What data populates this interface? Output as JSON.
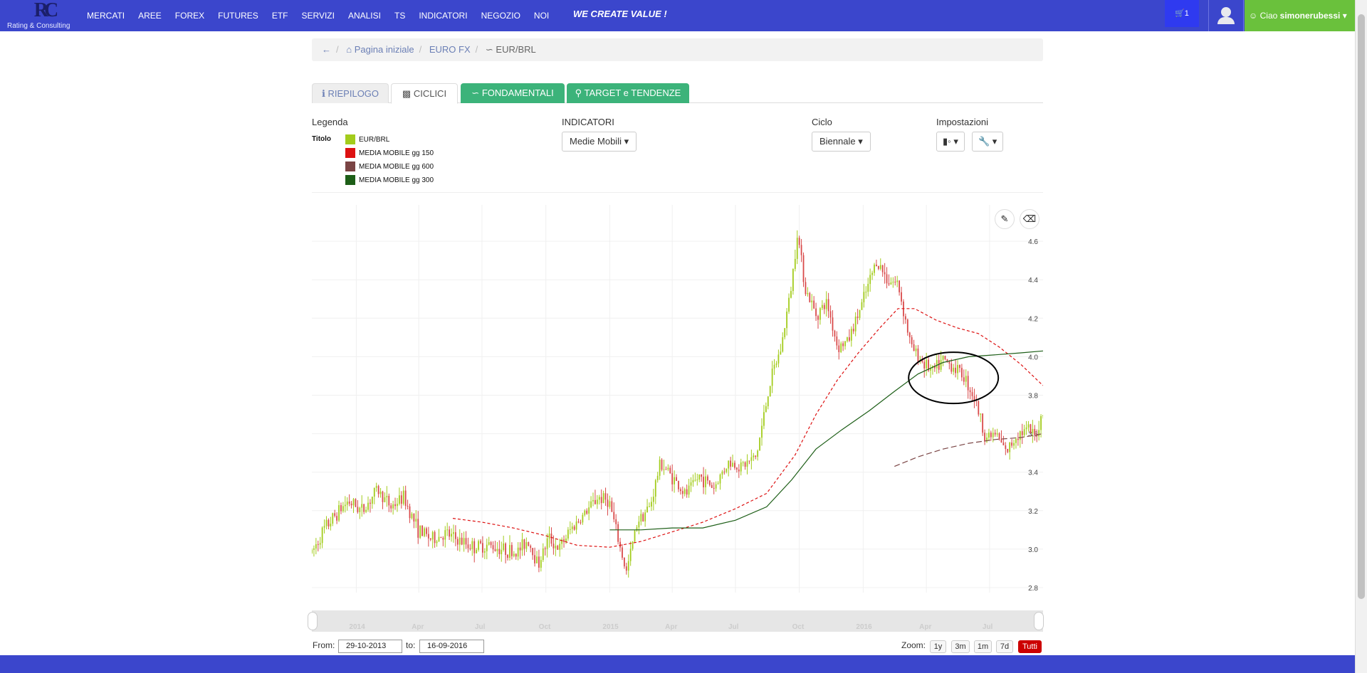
{
  "nav": {
    "logo_sub": "Rating & Consulting",
    "menu": [
      "MERCATI",
      "AREE",
      "FOREX",
      "FUTURES",
      "ETF",
      "SERVIZI",
      "ANALISI",
      "TS",
      "INDICATORI",
      "NEGOZIO",
      "NOI"
    ],
    "slogan": "WE CREATE VALUE !",
    "cart_count": "1",
    "greeting": "Ciao",
    "username": "simonerubessi"
  },
  "breadcrumb": {
    "home": "Pagina iniziale",
    "section": "EURO FX",
    "current": "EUR/BRL"
  },
  "tabs": {
    "riepilogo": "RIEPILOGO",
    "ciclici": "CICLICI",
    "fondamentali": "FONDAMENTALI",
    "target": "TARGET e TENDENZE"
  },
  "legend": {
    "title": "Legenda",
    "titolo_label": "Titolo",
    "items": [
      {
        "label": "EUR/BRL",
        "color": "#a3cc1c"
      },
      {
        "label": "MEDIA MOBILE gg 150",
        "color": "#dd1111"
      },
      {
        "label": "MEDIA MOBILE gg 600",
        "color": "#7a4444"
      },
      {
        "label": "MEDIA MOBILE gg 300",
        "color": "#1d5e17"
      }
    ]
  },
  "indicatori": {
    "title": "INDICATORI",
    "selected": "Medie Mobili"
  },
  "ciclo": {
    "title": "Ciclo",
    "selected": "Biennale"
  },
  "impostazioni": {
    "title": "Impostazioni"
  },
  "chart_data": {
    "type": "line",
    "series_name": "EUR/BRL",
    "ylim": [
      2.8,
      4.7
    ],
    "y_ticks": [
      "4.6",
      "4.4",
      "4.2",
      "4.0",
      "3.8",
      "3.6",
      "3.4",
      "3.2",
      "3.0",
      "2.8"
    ],
    "x_ticks": [
      "2014",
      "Apr",
      "Jul",
      "Oct",
      "2015",
      "Apr",
      "Jul",
      "Oct",
      "2016",
      "Apr",
      "Jul"
    ],
    "price": [
      [
        "2013-10-29",
        2.98
      ],
      [
        "2013-11-15",
        3.1
      ],
      [
        "2013-12-05",
        3.19
      ],
      [
        "2013-12-20",
        3.25
      ],
      [
        "2014-01-10",
        3.2
      ],
      [
        "2014-01-31",
        3.31
      ],
      [
        "2014-02-20",
        3.22
      ],
      [
        "2014-03-10",
        3.27
      ],
      [
        "2014-03-31",
        3.1
      ],
      [
        "2014-04-20",
        3.05
      ],
      [
        "2014-05-10",
        3.08
      ],
      [
        "2014-05-31",
        3.04
      ],
      [
        "2014-06-20",
        3.01
      ],
      [
        "2014-07-10",
        3.02
      ],
      [
        "2014-07-31",
        3.0
      ],
      [
        "2014-08-20",
        2.98
      ],
      [
        "2014-09-05",
        3.05
      ],
      [
        "2014-09-20",
        2.92
      ],
      [
        "2014-10-05",
        3.06
      ],
      [
        "2014-10-20",
        3.0
      ],
      [
        "2014-11-05",
        3.1
      ],
      [
        "2014-11-25",
        3.18
      ],
      [
        "2014-12-15",
        3.27
      ],
      [
        "2014-12-31",
        3.25
      ],
      [
        "2015-01-15",
        3.02
      ],
      [
        "2015-01-25",
        2.88
      ],
      [
        "2015-02-10",
        3.15
      ],
      [
        "2015-02-28",
        3.22
      ],
      [
        "2015-03-15",
        3.45
      ],
      [
        "2015-03-31",
        3.38
      ],
      [
        "2015-04-20",
        3.28
      ],
      [
        "2015-05-10",
        3.38
      ],
      [
        "2015-05-31",
        3.32
      ],
      [
        "2015-06-20",
        3.45
      ],
      [
        "2015-07-10",
        3.43
      ],
      [
        "2015-07-31",
        3.48
      ],
      [
        "2015-08-20",
        3.87
      ],
      [
        "2015-09-05",
        4.05
      ],
      [
        "2015-09-20",
        4.38
      ],
      [
        "2015-09-28",
        4.65
      ],
      [
        "2015-10-10",
        4.35
      ],
      [
        "2015-10-25",
        4.22
      ],
      [
        "2015-11-10",
        4.28
      ],
      [
        "2015-11-25",
        4.05
      ],
      [
        "2015-12-10",
        4.08
      ],
      [
        "2015-12-31",
        4.28
      ],
      [
        "2016-01-20",
        4.5
      ],
      [
        "2016-02-05",
        4.4
      ],
      [
        "2016-02-20",
        4.38
      ],
      [
        "2016-03-10",
        4.05
      ],
      [
        "2016-03-25",
        3.98
      ],
      [
        "2016-04-10",
        3.92
      ],
      [
        "2016-04-25",
        3.98
      ],
      [
        "2016-05-10",
        3.95
      ],
      [
        "2016-05-25",
        3.9
      ],
      [
        "2016-06-10",
        3.78
      ],
      [
        "2016-06-25",
        3.58
      ],
      [
        "2016-07-10",
        3.6
      ],
      [
        "2016-07-25",
        3.5
      ],
      [
        "2016-08-10",
        3.6
      ],
      [
        "2016-08-25",
        3.62
      ],
      [
        "2016-09-05",
        3.58
      ],
      [
        "2016-09-16",
        3.72
      ]
    ],
    "ma150": [
      [
        "2014-05-20",
        3.16
      ],
      [
        "2014-07-01",
        3.14
      ],
      [
        "2014-08-15",
        3.11
      ],
      [
        "2014-10-01",
        3.07
      ],
      [
        "2014-11-15",
        3.02
      ],
      [
        "2015-01-01",
        3.01
      ],
      [
        "2015-02-15",
        3.04
      ],
      [
        "2015-04-01",
        3.09
      ],
      [
        "2015-05-15",
        3.14
      ],
      [
        "2015-07-01",
        3.21
      ],
      [
        "2015-08-15",
        3.29
      ],
      [
        "2015-09-25",
        3.49
      ],
      [
        "2015-10-25",
        3.7
      ],
      [
        "2015-11-25",
        3.88
      ],
      [
        "2015-12-25",
        4.02
      ],
      [
        "2016-01-25",
        4.15
      ],
      [
        "2016-02-20",
        4.25
      ],
      [
        "2016-03-15",
        4.25
      ],
      [
        "2016-04-15",
        4.19
      ],
      [
        "2016-05-15",
        4.15
      ],
      [
        "2016-06-15",
        4.12
      ],
      [
        "2016-07-15",
        4.05
      ],
      [
        "2016-08-15",
        3.96
      ],
      [
        "2016-09-16",
        3.85
      ]
    ],
    "ma300": [
      [
        "2015-01-01",
        3.1
      ],
      [
        "2015-02-15",
        3.1
      ],
      [
        "2015-04-01",
        3.11
      ],
      [
        "2015-05-15",
        3.11
      ],
      [
        "2015-07-01",
        3.15
      ],
      [
        "2015-08-15",
        3.22
      ],
      [
        "2015-09-20",
        3.36
      ],
      [
        "2015-10-25",
        3.52
      ],
      [
        "2015-12-01",
        3.62
      ],
      [
        "2016-01-10",
        3.72
      ],
      [
        "2016-02-15",
        3.82
      ],
      [
        "2016-03-20",
        3.91
      ],
      [
        "2016-04-25",
        3.97
      ],
      [
        "2016-06-01",
        4.0
      ],
      [
        "2016-07-10",
        4.01
      ],
      [
        "2016-08-15",
        4.02
      ],
      [
        "2016-09-16",
        4.03
      ]
    ],
    "ma600": [
      [
        "2016-02-15",
        3.43
      ],
      [
        "2016-03-20",
        3.48
      ],
      [
        "2016-04-25",
        3.52
      ],
      [
        "2016-06-01",
        3.55
      ],
      [
        "2016-07-10",
        3.57
      ],
      [
        "2016-08-15",
        3.58
      ],
      [
        "2016-09-16",
        3.6
      ]
    ]
  },
  "range": {
    "from_label": "From:",
    "from": "29-10-2013",
    "to_label": "to:",
    "to": "16-09-2016"
  },
  "zoom": {
    "label": "Zoom:",
    "buttons": [
      "1y",
      "3m",
      "1m",
      "7d",
      "Tutti"
    ],
    "active": "Tutti"
  }
}
